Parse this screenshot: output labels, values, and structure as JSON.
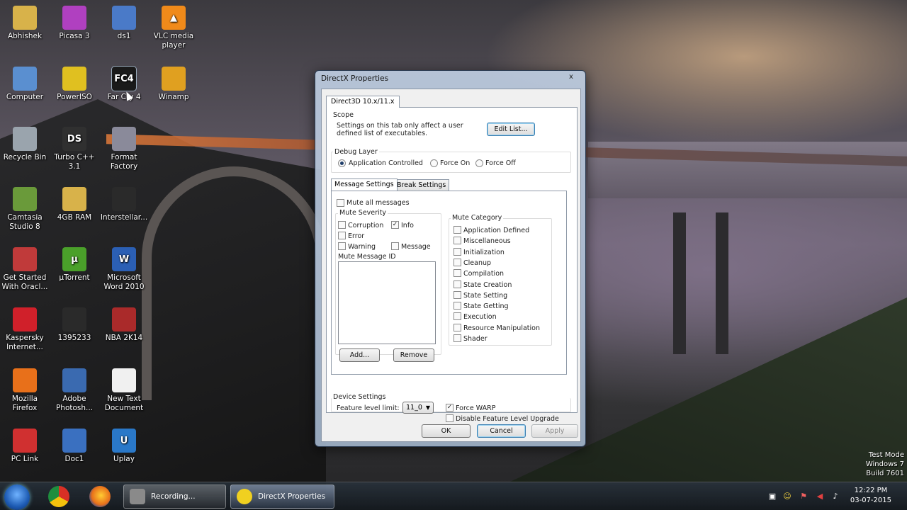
{
  "desktop": {
    "icons": [
      {
        "label": "Abhishek",
        "icon": "folder-icon",
        "color": "#d8b24a"
      },
      {
        "label": "Computer",
        "icon": "computer-icon",
        "color": "#5a8fd0"
      },
      {
        "label": "Recycle Bin",
        "icon": "recycle-bin-icon",
        "color": "#9aa4ad"
      },
      {
        "label": "Camtasia Studio 8",
        "icon": "camtasia-icon",
        "color": "#6a9a3a"
      },
      {
        "label": "Get Started With Oracl...",
        "icon": "oracle-icon",
        "color": "#c03a3a"
      },
      {
        "label": "Kaspersky Internet...",
        "icon": "kaspersky-icon",
        "color": "#d0202a"
      },
      {
        "label": "Mozilla Firefox",
        "icon": "firefox-icon",
        "color": "#e8701a"
      },
      {
        "label": "PC Link",
        "icon": "pc-link-icon",
        "color": "#d03030"
      },
      {
        "label": "Picasa 3",
        "icon": "picasa-icon",
        "color": "#b040c0"
      },
      {
        "label": "PowerISO",
        "icon": "poweriso-icon",
        "color": "#e0c020"
      },
      {
        "label": "Turbo C++ 3.1",
        "icon": "turbo-c-icon",
        "color": "#303030"
      },
      {
        "label": "4GB RAM",
        "icon": "folder-icon",
        "color": "#d8b24a"
      },
      {
        "label": "µTorrent",
        "icon": "utorrent-icon",
        "color": "#4aa02a"
      },
      {
        "label": "1395233",
        "icon": "image-icon",
        "color": "#2a2a2a"
      },
      {
        "label": "Adobe Photosh...",
        "icon": "photoshop-icon",
        "color": "#3a6ab0"
      },
      {
        "label": "Doc1",
        "icon": "word-doc-icon",
        "color": "#3a70c0"
      },
      {
        "label": "ds1",
        "icon": "document-icon",
        "color": "#4a7ac8"
      },
      {
        "label": "Far Cry 4",
        "icon": "farcry4-icon",
        "color": "#1a1a1a"
      },
      {
        "label": "Format Factory",
        "icon": "format-factory-icon",
        "color": "#8a8a9a"
      },
      {
        "label": "Interstellar...",
        "icon": "video-icon",
        "color": "#2a2a2a"
      },
      {
        "label": "Microsoft Word 2010",
        "icon": "word-icon",
        "color": "#2b5fb4"
      },
      {
        "label": "NBA 2K14",
        "icon": "nba-icon",
        "color": "#aa2a2a"
      },
      {
        "label": "New Text Document",
        "icon": "text-file-icon",
        "color": "#f0f0f0"
      },
      {
        "label": "Uplay",
        "icon": "uplay-icon",
        "color": "#2a78c8"
      },
      {
        "label": "VLC media player",
        "icon": "vlc-icon",
        "color": "#f08a1a"
      },
      {
        "label": "Winamp",
        "icon": "winamp-icon",
        "color": "#e0a020"
      }
    ],
    "icon_glyphs": {
      "farcry": "FC4",
      "word": "W",
      "vlc": "▲",
      "turbo": "DS",
      "utorrent": "µ",
      "uplay": "U"
    }
  },
  "dialog": {
    "title": "DirectX Properties",
    "close_glyph": "x",
    "tab": "Direct3D 10.x/11.x",
    "scope": {
      "label": "Scope",
      "text_line1": "Settings on this tab only affect a user",
      "text_line2": "defined list of executables.",
      "edit_button": "Edit List..."
    },
    "debug_layer": {
      "label": "Debug Layer",
      "options": [
        "Application Controlled",
        "Force On",
        "Force Off"
      ],
      "selected": "Application Controlled"
    },
    "inner_tabs": [
      "Message Settings",
      "Break Settings"
    ],
    "message_settings": {
      "mute_all": "Mute all messages",
      "mute_severity": {
        "label": "Mute Severity",
        "items": [
          {
            "label": "Corruption",
            "checked": false
          },
          {
            "label": "Info",
            "checked": true
          },
          {
            "label": "Error",
            "checked": false
          },
          {
            "label": "Warning",
            "checked": false
          },
          {
            "label": "Message",
            "checked": false
          }
        ]
      },
      "mute_message_id": {
        "label": "Mute Message ID",
        "add_button": "Add...",
        "remove_button": "Remove"
      },
      "mute_category": {
        "label": "Mute Category",
        "items": [
          "Application Defined",
          "Miscellaneous",
          "Initialization",
          "Cleanup",
          "Compilation",
          "State Creation",
          "State Setting",
          "State Getting",
          "Execution",
          "Resource Manipulation",
          "Shader"
        ]
      }
    },
    "device_settings": {
      "label": "Device Settings",
      "feature_level_label": "Feature level limit:",
      "feature_level_value": "11_0",
      "force_warp": {
        "label": "Force WARP",
        "checked": true
      },
      "disable_upgrade": {
        "label": "Disable Feature Level Upgrade",
        "checked": false
      }
    },
    "buttons": {
      "ok": "OK",
      "cancel": "Cancel",
      "apply": "Apply"
    },
    "check_glyph": "✓"
  },
  "taskbar": {
    "tasks": [
      {
        "label": "Recording...",
        "icon": "recording-icon"
      },
      {
        "label": "DirectX Properties",
        "icon": "directx-icon"
      }
    ],
    "clock_time": "12:22 PM",
    "clock_date": "03-07-2015"
  },
  "watermark": {
    "line1": "Test Mode",
    "line2": "Windows 7",
    "line3": "Build 7601"
  },
  "colors": {
    "chrome_blue": "#1f6fc4",
    "firefox_orange": "#e8701a",
    "directx_yellow": "#f0d020"
  }
}
